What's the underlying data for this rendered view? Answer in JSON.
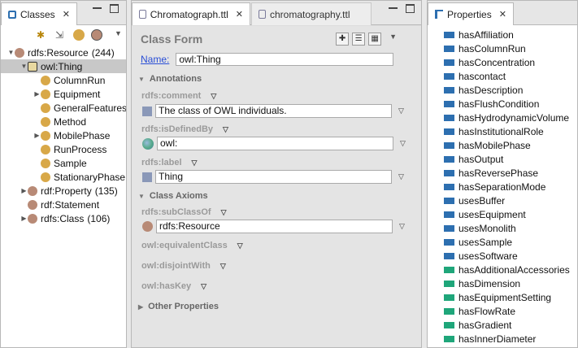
{
  "left_panel": {
    "tab_label": "Classes",
    "tree": [
      {
        "label": "rdfs:Resource",
        "count": "(244)",
        "indent": 0,
        "twisty": "▼",
        "dot": "brown",
        "selected": false
      },
      {
        "label": "owl:Thing",
        "count": "",
        "indent": 1,
        "twisty": "▼",
        "dot": "arrow",
        "selected": true
      },
      {
        "label": "ColumnRun",
        "count": "",
        "indent": 2,
        "twisty": "",
        "dot": "gold",
        "selected": false
      },
      {
        "label": "Equipment",
        "count": "",
        "indent": 2,
        "twisty": "▶",
        "dot": "gold",
        "selected": false
      },
      {
        "label": "GeneralFeatures",
        "count": "",
        "indent": 2,
        "twisty": "",
        "dot": "gold",
        "selected": false
      },
      {
        "label": "Method",
        "count": "",
        "indent": 2,
        "twisty": "",
        "dot": "gold",
        "selected": false
      },
      {
        "label": "MobilePhase",
        "count": "",
        "indent": 2,
        "twisty": "▶",
        "dot": "gold",
        "selected": false
      },
      {
        "label": "RunProcess",
        "count": "",
        "indent": 2,
        "twisty": "",
        "dot": "gold",
        "selected": false
      },
      {
        "label": "Sample",
        "count": "",
        "indent": 2,
        "twisty": "",
        "dot": "gold",
        "selected": false
      },
      {
        "label": "StationaryPhase",
        "count": "",
        "indent": 2,
        "twisty": "",
        "dot": "gold",
        "selected": false
      },
      {
        "label": "rdf:Property",
        "count": "(135)",
        "indent": 1,
        "twisty": "▶",
        "dot": "brown",
        "selected": false
      },
      {
        "label": "rdf:Statement",
        "count": "",
        "indent": 1,
        "twisty": "",
        "dot": "brown",
        "selected": false
      },
      {
        "label": "rdfs:Class",
        "count": "(106)",
        "indent": 1,
        "twisty": "▶",
        "dot": "brown",
        "selected": false
      }
    ]
  },
  "editor": {
    "tabs": [
      {
        "label": "Chromatograph.ttl",
        "active": true
      },
      {
        "label": "chromatography.ttl",
        "active": false
      }
    ],
    "form_title": "Class Form",
    "name_label": "Name:",
    "name_value": "owl:Thing",
    "annotations_label": "Annotations",
    "comment_label": "rdfs:comment",
    "comment_value": "The class of OWL individuals.",
    "defined_by_label": "rdfs:isDefinedBy",
    "defined_by_value": "owl:",
    "label_label": "rdfs:label",
    "label_value": "Thing",
    "class_axioms_label": "Class Axioms",
    "subclassof_label": "rdfs:subClassOf",
    "subclassof_value": "rdfs:Resource",
    "equivalent_label": "owl:equivalentClass",
    "disjoint_label": "owl:disjointWith",
    "haskey_label": "owl:hasKey",
    "other_props_label": "Other Properties"
  },
  "right_panel": {
    "tab_label": "Properties",
    "items": [
      {
        "label": "hasAffiliation",
        "kind": "obj"
      },
      {
        "label": "hasColumnRun",
        "kind": "obj"
      },
      {
        "label": "hasConcentration",
        "kind": "obj"
      },
      {
        "label": "hascontact",
        "kind": "obj"
      },
      {
        "label": "hasDescription",
        "kind": "obj"
      },
      {
        "label": "hasFlushCondition",
        "kind": "obj"
      },
      {
        "label": "hasHydrodynamicVolume",
        "kind": "obj"
      },
      {
        "label": "hasInstitutionalRole",
        "kind": "obj"
      },
      {
        "label": "hasMobilePhase",
        "kind": "obj"
      },
      {
        "label": "hasOutput",
        "kind": "obj"
      },
      {
        "label": "hasReversePhase",
        "kind": "obj"
      },
      {
        "label": "hasSeparationMode",
        "kind": "obj"
      },
      {
        "label": "usesBuffer",
        "kind": "obj"
      },
      {
        "label": "usesEquipment",
        "kind": "obj"
      },
      {
        "label": "usesMonolith",
        "kind": "obj"
      },
      {
        "label": "usesSample",
        "kind": "obj"
      },
      {
        "label": "usesSoftware",
        "kind": "obj"
      },
      {
        "label": "hasAdditionalAccessories",
        "kind": "data"
      },
      {
        "label": "hasDimension",
        "kind": "data"
      },
      {
        "label": "hasEquipmentSetting",
        "kind": "data"
      },
      {
        "label": "hasFlowRate",
        "kind": "data"
      },
      {
        "label": "hasGradient",
        "kind": "data"
      },
      {
        "label": "hasInnerDiameter",
        "kind": "data"
      }
    ]
  },
  "colors": {
    "object_property": "#2d6fb0",
    "data_property": "#1fa67a",
    "selection": "#c8c8c8",
    "link": "#2a4fd6"
  }
}
